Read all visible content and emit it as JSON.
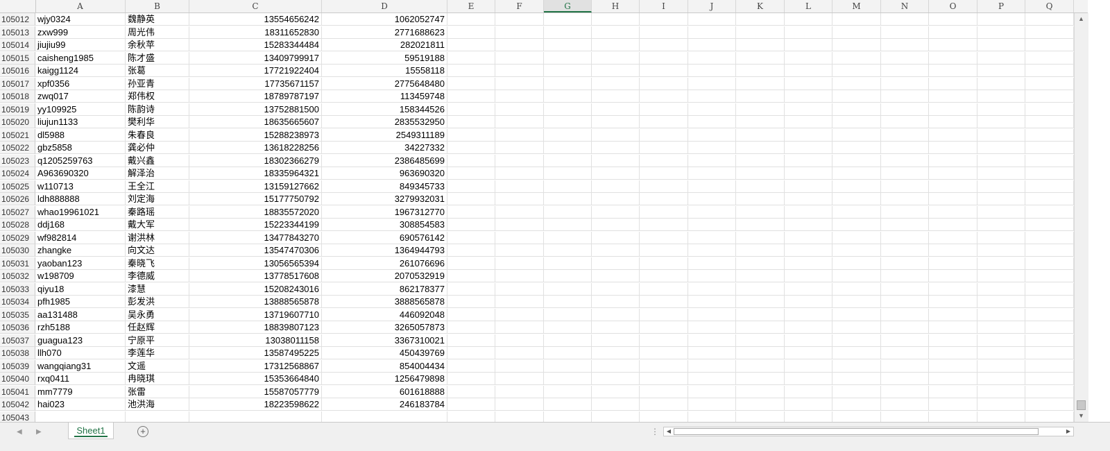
{
  "columns": [
    "A",
    "B",
    "C",
    "D",
    "E",
    "F",
    "G",
    "H",
    "I",
    "J",
    "K",
    "L",
    "M",
    "N",
    "O",
    "P",
    "Q"
  ],
  "active_column": "G",
  "rows": [
    {
      "num": "105012",
      "a": "wjy0324",
      "b": "魏静英",
      "c": "13554656242",
      "d": "1062052747"
    },
    {
      "num": "105013",
      "a": "zxw999",
      "b": "周光伟",
      "c": "18311652830",
      "d": "2771688623"
    },
    {
      "num": "105014",
      "a": "jiujiu99",
      "b": "余秋苹",
      "c": "15283344484",
      "d": "282021811"
    },
    {
      "num": "105015",
      "a": "caisheng1985",
      "b": "陈才盛",
      "c": "13409799917",
      "d": "59519188"
    },
    {
      "num": "105016",
      "a": "kaigg1124",
      "b": "张葛",
      "c": "17721922404",
      "d": "15558118"
    },
    {
      "num": "105017",
      "a": "xpf0356",
      "b": "孙亚青",
      "c": "17735671157",
      "d": "2775648480"
    },
    {
      "num": "105018",
      "a": "zwq017",
      "b": "郑伟权",
      "c": "18789787197",
      "d": "113459748"
    },
    {
      "num": "105019",
      "a": "yy109925",
      "b": "陈韵诗",
      "c": "13752881500",
      "d": "158344526"
    },
    {
      "num": "105020",
      "a": "liujun1133",
      "b": "樊利华",
      "c": "18635665607",
      "d": "2835532950"
    },
    {
      "num": "105021",
      "a": "dl5988",
      "b": "朱春良",
      "c": "15288238973",
      "d": "2549311189"
    },
    {
      "num": "105022",
      "a": "gbz5858",
      "b": "龚必仲",
      "c": "13618228256",
      "d": "34227332"
    },
    {
      "num": "105023",
      "a": "q1205259763",
      "b": "戴兴鑫",
      "c": "18302366279",
      "d": "2386485699"
    },
    {
      "num": "105024",
      "a": "A963690320",
      "b": "解泽治",
      "c": "18335964321",
      "d": "963690320"
    },
    {
      "num": "105025",
      "a": "w110713",
      "b": "王全江",
      "c": "13159127662",
      "d": "849345733"
    },
    {
      "num": "105026",
      "a": "ldh888888",
      "b": "刘定海",
      "c": "15177750792",
      "d": "3279932031"
    },
    {
      "num": "105027",
      "a": "whao19961021",
      "b": "秦路瑶",
      "c": "18835572020",
      "d": "1967312770"
    },
    {
      "num": "105028",
      "a": "ddj168",
      "b": "戴大军",
      "c": "15223344199",
      "d": "308854583"
    },
    {
      "num": "105029",
      "a": "wf982814",
      "b": "谢洪林",
      "c": "13477843270",
      "d": "690576142"
    },
    {
      "num": "105030",
      "a": "zhangke",
      "b": "向文达",
      "c": "13547470306",
      "d": "1364944793"
    },
    {
      "num": "105031",
      "a": "yaoban123",
      "b": "秦晓飞",
      "c": "13056565394",
      "d": "261076696"
    },
    {
      "num": "105032",
      "a": "w198709",
      "b": "李德威",
      "c": "13778517608",
      "d": "2070532919"
    },
    {
      "num": "105033",
      "a": "qiyu18",
      "b": "漆慧",
      "c": "15208243016",
      "d": "862178377"
    },
    {
      "num": "105034",
      "a": "pfh1985",
      "b": "彭发洪",
      "c": "13888565878",
      "d": "3888565878"
    },
    {
      "num": "105035",
      "a": "aa131488",
      "b": "吴永勇",
      "c": "13719607710",
      "d": "446092048"
    },
    {
      "num": "105036",
      "a": "rzh5188",
      "b": "任赵辉",
      "c": "18839807123",
      "d": "3265057873"
    },
    {
      "num": "105037",
      "a": "guagua123",
      "b": "宁原平",
      "c": "13038011158",
      "d": "3367310021"
    },
    {
      "num": "105038",
      "a": "llh070",
      "b": "李莲华",
      "c": "13587495225",
      "d": "450439769"
    },
    {
      "num": "105039",
      "a": "wangqiang31",
      "b": "文遥",
      "c": "17312568867",
      "d": "854004434"
    },
    {
      "num": "105040",
      "a": "rxq0411",
      "b": "冉晓琪",
      "c": "15353664840",
      "d": "1256479898"
    },
    {
      "num": "105041",
      "a": "mm7779",
      "b": "张雷",
      "c": "15587057779",
      "d": "601618888"
    },
    {
      "num": "105042",
      "a": "hai023",
      "b": "池洪海",
      "c": "18223598622",
      "d": "246183784"
    },
    {
      "num": "105043",
      "a": "",
      "b": "",
      "c": "",
      "d": ""
    }
  ],
  "sheet_tab": {
    "label": "Sheet1"
  },
  "add_sheet": {
    "label": "+"
  },
  "colors": {
    "accent": "#217346",
    "grid": "#e0e0e0",
    "header_bg": "#f3f3f3"
  }
}
